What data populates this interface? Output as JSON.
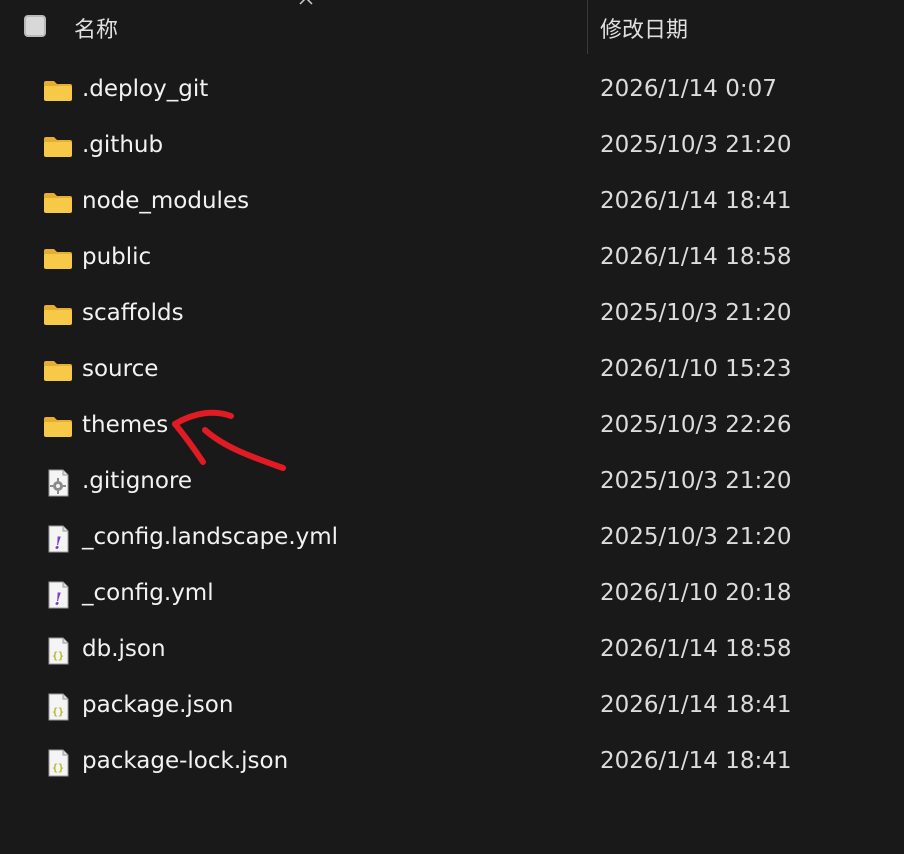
{
  "header": {
    "name_label": "名称",
    "date_label": "修改日期"
  },
  "files": [
    {
      "name": ".deploy_git",
      "date": "2026/1/14 0:07",
      "icon": "folder-icon"
    },
    {
      "name": ".github",
      "date": "2025/10/3 21:20",
      "icon": "folder-icon"
    },
    {
      "name": "node_modules",
      "date": "2026/1/14 18:41",
      "icon": "folder-icon"
    },
    {
      "name": "public",
      "date": "2026/1/14 18:58",
      "icon": "folder-icon"
    },
    {
      "name": "scaffolds",
      "date": "2025/10/3 21:20",
      "icon": "folder-icon"
    },
    {
      "name": "source",
      "date": "2026/1/10 15:23",
      "icon": "folder-icon"
    },
    {
      "name": "themes",
      "date": "2025/10/3 22:26",
      "icon": "folder-icon"
    },
    {
      "name": ".gitignore",
      "date": "2025/10/3 21:20",
      "icon": "settings-file-icon"
    },
    {
      "name": "_config.landscape.yml",
      "date": "2025/10/3 21:20",
      "icon": "yaml-file-icon"
    },
    {
      "name": "_config.yml",
      "date": "2026/1/10 20:18",
      "icon": "yaml-file-icon"
    },
    {
      "name": "db.json",
      "date": "2026/1/14 18:58",
      "icon": "json-file-icon"
    },
    {
      "name": "package.json",
      "date": "2026/1/14 18:41",
      "icon": "json-file-icon"
    },
    {
      "name": "package-lock.json",
      "date": "2026/1/14 18:41",
      "icon": "json-file-icon"
    }
  ],
  "annotation": {
    "target": "themes",
    "color": "#e01b24",
    "icon": "red-arrow-annotation"
  },
  "colors": {
    "background": "#191919",
    "folder": "#f7c948",
    "yaml_mark": "#7a3fd1",
    "json_mark": "#b5b52a"
  }
}
